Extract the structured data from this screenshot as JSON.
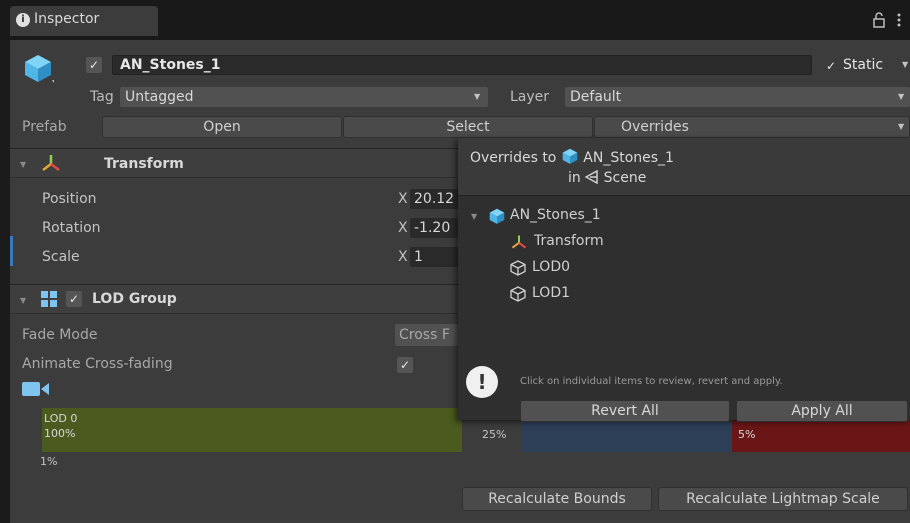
{
  "window": {
    "tab_title": "Inspector"
  },
  "header": {
    "object_name": "AN_Stones_1",
    "static_label": "Static",
    "tag_label": "Tag",
    "tag_value": "Untagged",
    "layer_label": "Layer",
    "layer_value": "Default"
  },
  "prefab": {
    "label": "Prefab",
    "open_label": "Open",
    "select_label": "Select",
    "overrides_label": "Overrides"
  },
  "transform": {
    "title": "Transform",
    "position_label": "Position",
    "rotation_label": "Rotation",
    "scale_label": "Scale",
    "axis_x": "X",
    "position_x": "20.12",
    "rotation_x": "-1.20",
    "scale_x": "1"
  },
  "lod_group": {
    "title": "LOD Group",
    "fade_mode_label": "Fade Mode",
    "fade_mode_value": "Cross F",
    "animate_label": "Animate Cross-fading",
    "lod0_label": "LOD 0",
    "lod0_pct": "100%",
    "lod_1pct": "1%",
    "lod1_pct": "25%",
    "lod2_pct": "5%",
    "recalc_bounds": "Recalculate Bounds",
    "recalc_lightmap": "Recalculate Lightmap Scale"
  },
  "overrides_popup": {
    "title_prefix": "Overrides to",
    "title_name": "AN_Stones_1",
    "in_prefix": "in",
    "scene_label": "Scene",
    "tree": [
      "AN_Stones_1",
      "Transform",
      "LOD0",
      "LOD1"
    ],
    "info_text": "Click on individual items to review, revert and apply.",
    "revert_all": "Revert All",
    "apply_all": "Apply All"
  },
  "colors": {
    "panel": "#3c3c3c",
    "lod0": "#4b5a1e",
    "lod1": "#2d3f57",
    "lod2": "#6a1616",
    "selection": "#3a79bb",
    "prefab_blue": "#4fb6e8"
  }
}
